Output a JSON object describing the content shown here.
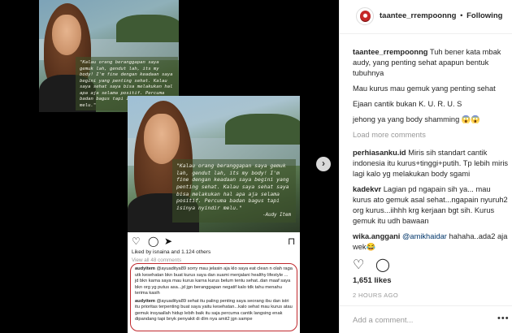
{
  "header": {
    "username": "taantee_rrempoonng",
    "separator": "•",
    "follow_label": "Following"
  },
  "post_image": {
    "quote_back": "\"Kalau orang beranggapan saya gemuk lah, gendut lah, its my body! I'm fine dengan keadaan saya begini yang penting sehat. Kalau saya sehat saya bisa melakukan hal apa aja selama positif. Percuma badan bagus tapi isinya nyindir melu.\"",
    "quote_front": "\"Kalau orang beranggapan saya gemuk lah, gendut lah, its my body! I'm fine dengan keadaan saya begini yang penting sehat. Kalau saya sehat saya bisa melakukan hal apa aja selama positif. Percuma badan bagus tapi isinya nyindir melu.\"",
    "quote_author": "-Audy Item",
    "next_arrow": "›"
  },
  "inner_post": {
    "likes": "Liked by isnaina and 1.124 others",
    "view_all": "View all 48 comments",
    "comments": [
      {
        "user": "audyitem",
        "text": "@ayuaditya89 sorry mau jelasin aja klo saya eat clean n olah raga utk kesehatan bkn buat kurus saya dan suami menjalani healthy lifestyle ... jd bkn karna saya mau kurus karna kurus belum tentu sehat..dan maaf saya bkn org yg putus asa...jd jgn beranggapan negatif kalo tdk tahu menahu terima kasih"
      },
      {
        "user": "audyitem",
        "text": "@ayuaditya89 sehat itu paling penting saya seorang ibu dan istri itu prioritas terpenting buat saya yaitu kesehatan...kalo sehat mau kurus atau gemuk insyaallah hidup lebih baik itu saja percuma cantik langsing enak dipandang tapi bnyk penyakit di dlm nya amit2 jgn sampe"
      }
    ]
  },
  "caption": {
    "user": "taantee_rrempoonng",
    "text": "Tuh bener kata mbak audy, yang penting sehat apapun bentuk tubuhnya",
    "lines": [
      "Mau kurus mau gemuk yang penting sehat",
      "Ejaan cantik bukan K. U. R. U. S",
      "jehong ya yang body shamming 😱😱"
    ]
  },
  "load_more": "Load more comments",
  "comments": [
    {
      "user": "perhiasanku.id",
      "text": "Miris sih standart cantik indonesia itu kurus+tinggi+putih. Tp lebih miris lagi kalo yg melakukan body sgami"
    },
    {
      "user": "kadekvr",
      "text": "Lagian pd ngapain sih ya... mau kurus ato gemuk asal sehat...ngapain nyuruh2 org kurus...iihhh krg kerjaan bgt sih. Kurus gemuk itu udh bawaan"
    },
    {
      "user": "wika.anggani",
      "mention": "@amikhaidar",
      "text": "hahaha..ada2 aja wek😂"
    }
  ],
  "likes": "1,651 likes",
  "time_ago": "2 HOURS AGO",
  "add_comment_placeholder": "Add a comment...",
  "more_label": "•••"
}
